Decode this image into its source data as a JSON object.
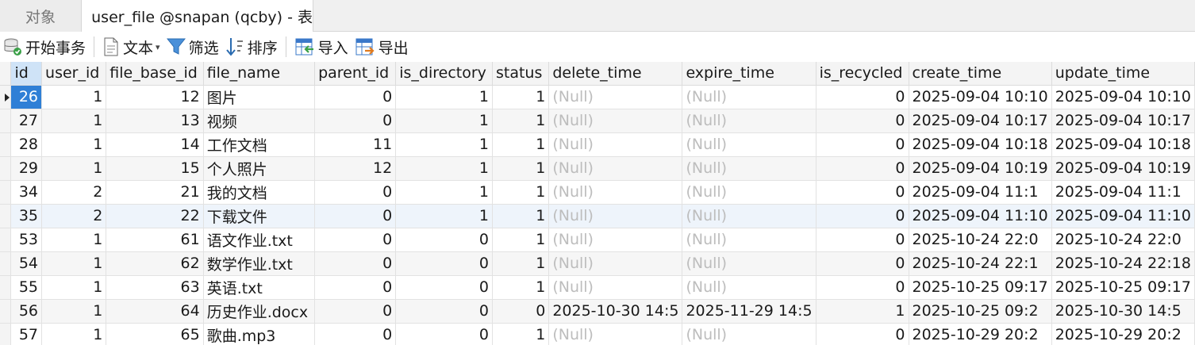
{
  "tabs": {
    "objects": "对象",
    "active": "user_file @snapan (qcby) - 表"
  },
  "toolbar": {
    "begin_transaction": "开始事务",
    "text": "文本",
    "filter": "筛选",
    "sort": "排序",
    "import": "导入",
    "export": "导出"
  },
  "table": {
    "columns": [
      "id",
      "user_id",
      "file_base_id",
      "file_name",
      "parent_id",
      "is_directory",
      "status",
      "delete_time",
      "expire_time",
      "is_recycled",
      "create_time",
      "update_time"
    ],
    "rows": [
      [
        "26",
        "1",
        "12",
        "图片",
        "0",
        "1",
        "1",
        "(Null)",
        "(Null)",
        "0",
        "2025-09-04 10:10",
        "2025-09-04 10:10"
      ],
      [
        "27",
        "1",
        "13",
        "视频",
        "0",
        "1",
        "1",
        "(Null)",
        "(Null)",
        "0",
        "2025-09-04 10:17",
        "2025-09-04 10:17"
      ],
      [
        "28",
        "1",
        "14",
        "工作文档",
        "11",
        "1",
        "1",
        "(Null)",
        "(Null)",
        "0",
        "2025-09-04 10:18",
        "2025-09-04 10:18"
      ],
      [
        "29",
        "1",
        "15",
        "个人照片",
        "12",
        "1",
        "1",
        "(Null)",
        "(Null)",
        "0",
        "2025-09-04 10:19",
        "2025-09-04 10:19"
      ],
      [
        "34",
        "2",
        "21",
        "我的文档",
        "0",
        "1",
        "1",
        "(Null)",
        "(Null)",
        "0",
        "2025-09-04 11:1",
        "2025-09-04 11:1"
      ],
      [
        "35",
        "2",
        "22",
        "下载文件",
        "0",
        "1",
        "1",
        "(Null)",
        "(Null)",
        "0",
        "2025-09-04 11:10",
        "2025-09-04 11:10"
      ],
      [
        "53",
        "1",
        "61",
        "语文作业.txt",
        "0",
        "0",
        "1",
        "(Null)",
        "(Null)",
        "0",
        "2025-10-24 22:0",
        "2025-10-24 22:0"
      ],
      [
        "54",
        "1",
        "62",
        "数学作业.txt",
        "0",
        "0",
        "1",
        "(Null)",
        "(Null)",
        "0",
        "2025-10-24 22:1",
        "2025-10-24 22:18"
      ],
      [
        "55",
        "1",
        "63",
        "英语.txt",
        "0",
        "0",
        "1",
        "(Null)",
        "(Null)",
        "0",
        "2025-10-25 09:17",
        "2025-10-25 09:17"
      ],
      [
        "56",
        "1",
        "64",
        "历史作业.docx",
        "0",
        "0",
        "0",
        "2025-10-30 14:5",
        "2025-11-29 14:5",
        "1",
        "2025-10-25 09:2",
        "2025-10-30 14:5"
      ],
      [
        "57",
        "1",
        "65",
        "歌曲.mp3",
        "0",
        "0",
        "1",
        "(Null)",
        "(Null)",
        "0",
        "2025-10-29 20:2",
        "2025-10-29 20:2"
      ]
    ],
    "current_row": 0,
    "highlighted_row": 5
  }
}
